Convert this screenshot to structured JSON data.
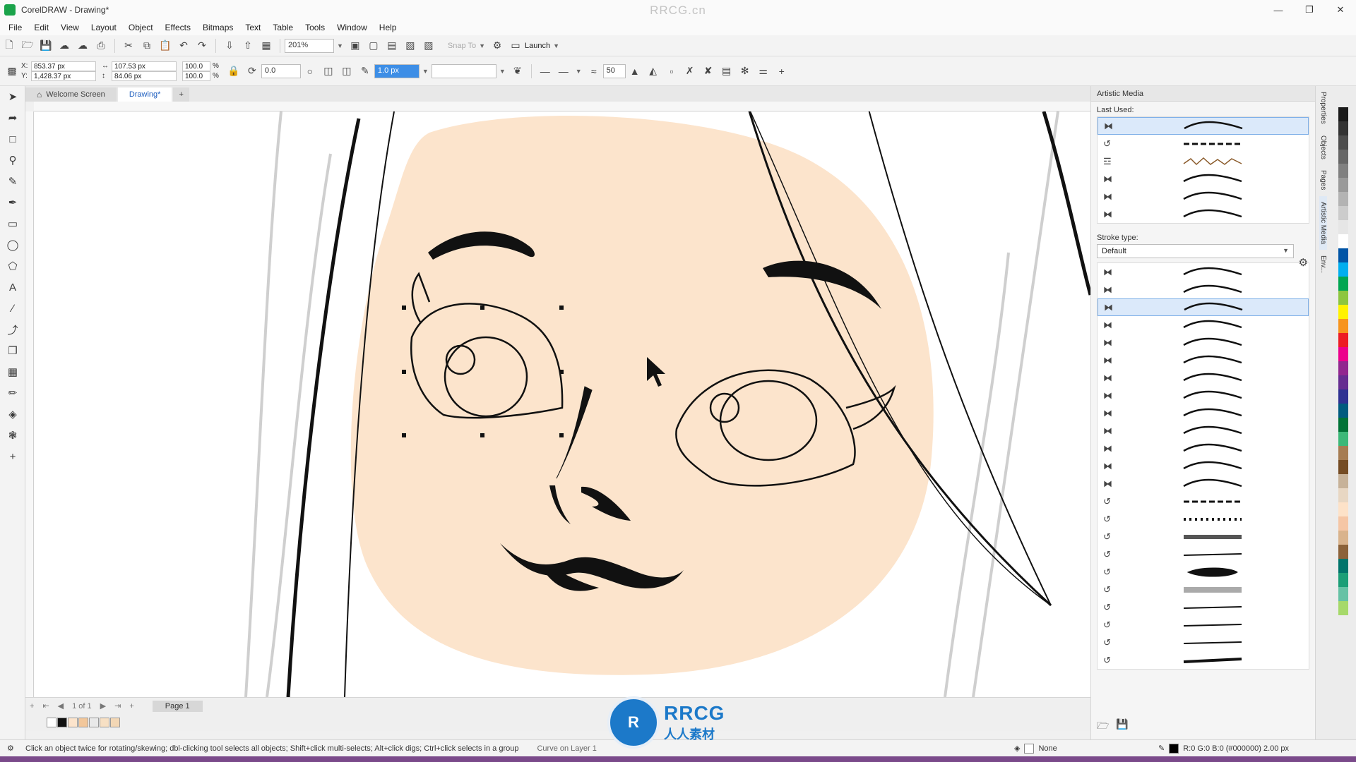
{
  "window": {
    "title": "CorelDRAW - Drawing*",
    "watermark": "RRCG.cn"
  },
  "menu": [
    "File",
    "Edit",
    "View",
    "Layout",
    "Object",
    "Effects",
    "Bitmaps",
    "Text",
    "Table",
    "Tools",
    "Window",
    "Help"
  ],
  "standard_toolbar": {
    "zoom": "201%",
    "snap_to": "Snap To",
    "launch": "Launch"
  },
  "property_bar": {
    "x": "853.37 px",
    "y": "1,428.37 px",
    "w": "107.53 px",
    "h": "84.06 px",
    "scale_x": "100.0",
    "scale_y": "100.0",
    "percent": "%",
    "rotation": "0.0",
    "stroke_width": "1.0 px",
    "smoothing": "50"
  },
  "doc_tabs": [
    {
      "label": "Welcome Screen",
      "active": false
    },
    {
      "label": "Drawing*",
      "active": true
    }
  ],
  "page_nav": {
    "counter": "1 of 1",
    "page_tab": "Page 1"
  },
  "statusbar": {
    "hint": "Click an object twice for rotating/skewing; dbl-clicking tool selects all objects; Shift+click multi-selects; Alt+click digs; Ctrl+click selects in a group",
    "object": "Curve on Layer 1",
    "fill": "None",
    "stroke": "R:0 G:0 B:0 (#000000)  2.00 px"
  },
  "brand": {
    "en": "RRCG",
    "cn": "人人素材"
  },
  "docker": {
    "title": "Artistic Media",
    "last_used_label": "Last Used:",
    "stroke_type_label": "Stroke type:",
    "stroke_type_value": "Default",
    "last_used": [
      {
        "kind": "brush",
        "preview": "wave",
        "selected": true
      },
      {
        "kind": "spray",
        "preview": "dash"
      },
      {
        "kind": "pattern",
        "preview": "sketch"
      },
      {
        "kind": "brush",
        "preview": "wave"
      },
      {
        "kind": "brush",
        "preview": "wave"
      },
      {
        "kind": "brush",
        "preview": "wave"
      }
    ],
    "strokes": [
      {
        "kind": "brush",
        "preview": "wave"
      },
      {
        "kind": "brush",
        "preview": "wave"
      },
      {
        "kind": "brush",
        "preview": "wave",
        "selected": true
      },
      {
        "kind": "brush",
        "preview": "wave"
      },
      {
        "kind": "brush",
        "preview": "wave"
      },
      {
        "kind": "brush",
        "preview": "wave"
      },
      {
        "kind": "brush",
        "preview": "wave"
      },
      {
        "kind": "brush",
        "preview": "wave"
      },
      {
        "kind": "brush",
        "preview": "wave"
      },
      {
        "kind": "brush",
        "preview": "wave"
      },
      {
        "kind": "brush",
        "preview": "wave"
      },
      {
        "kind": "brush",
        "preview": "wave"
      },
      {
        "kind": "brush",
        "preview": "wave"
      },
      {
        "kind": "spray",
        "preview": "dash"
      },
      {
        "kind": "spray",
        "preview": "dots"
      },
      {
        "kind": "spray",
        "preview": "rough"
      },
      {
        "kind": "spray",
        "preview": "line"
      },
      {
        "kind": "spray",
        "preview": "blob"
      },
      {
        "kind": "spray",
        "preview": "blur"
      },
      {
        "kind": "spray",
        "preview": "line"
      },
      {
        "kind": "spray",
        "preview": "line"
      },
      {
        "kind": "spray",
        "preview": "line"
      },
      {
        "kind": "spray",
        "preview": "thick"
      }
    ]
  },
  "side_tabs": [
    "Properties",
    "Objects",
    "Pages",
    "Artistic Media",
    "Env..."
  ],
  "palette": [
    "#1a1a1a",
    "#333333",
    "#4d4d4d",
    "#666666",
    "#808080",
    "#999999",
    "#b3b3b3",
    "#cccccc",
    "#e6e6e6",
    "#ffffff",
    "#0054a6",
    "#00aeef",
    "#00a651",
    "#8dc63f",
    "#fff200",
    "#f7941d",
    "#ed1c24",
    "#ec008c",
    "#92278f",
    "#662d91",
    "#2e3192",
    "#005b7f",
    "#007236",
    "#3cb878",
    "#a67c52",
    "#754c24",
    "#c7b299",
    "#e8d7c3",
    "#fde2c8",
    "#f5c6a5",
    "#d9b38c",
    "#8c6239",
    "#00746b",
    "#1b9e77",
    "#66c2a5",
    "#a6d96a"
  ],
  "colors": {
    "skin": "#fce4cc",
    "accent_blue": "#3d8ee6",
    "selection_bg": "#dbe9fa"
  }
}
